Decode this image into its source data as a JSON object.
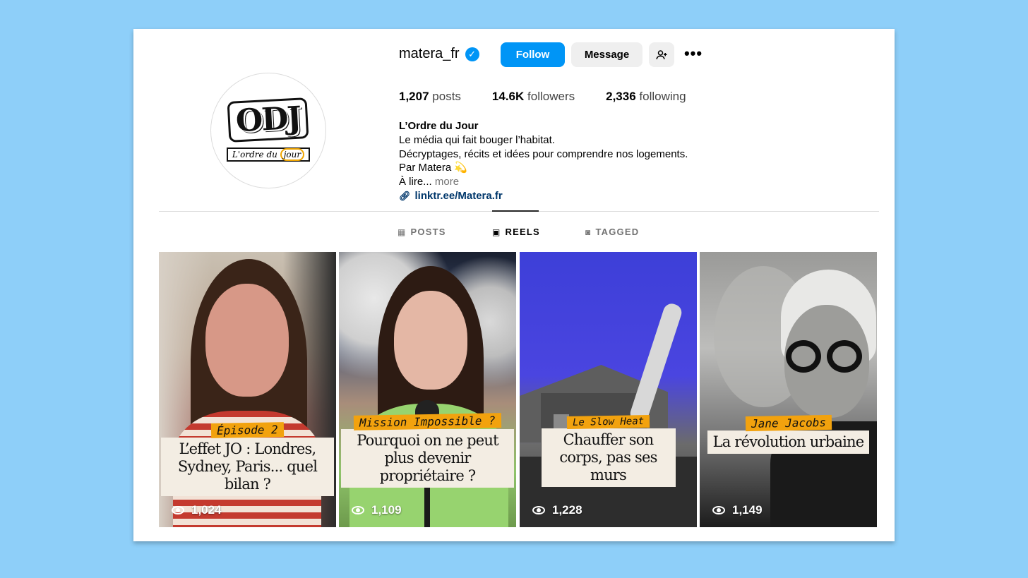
{
  "profile": {
    "username": "matera_fr",
    "verified_icon": "verified-badge-icon",
    "follow_label": "Follow",
    "message_label": "Message",
    "add_user_icon": "add-user-icon",
    "more_icon": "more-options-icon",
    "avatar": {
      "logo_text": "ODJ",
      "logo_subtitle_pre": "L'ordre du",
      "logo_subtitle_highlight": "jour"
    }
  },
  "stats": [
    {
      "value": "1,207",
      "label": "posts"
    },
    {
      "value": "14.6K",
      "label": "followers"
    },
    {
      "value": "2,336",
      "label": "following"
    }
  ],
  "bio": {
    "name": "L’Ordre du Jour",
    "line1": "Le média qui fait bouger l’habitat.",
    "line2": "Décryptages, récits et idées pour comprendre nos logements.",
    "line3": "Par Matera 💫",
    "line4_prefix": "À lire...",
    "more": "more",
    "link": "linktr.ee/Matera.fr"
  },
  "tabs": [
    {
      "label": "POSTS",
      "icon": "grid-icon",
      "active": false
    },
    {
      "label": "REELS",
      "icon": "reels-icon",
      "active": true
    },
    {
      "label": "TAGGED",
      "icon": "tagged-icon",
      "active": false
    }
  ],
  "reels": [
    {
      "tag": "Épisode 2",
      "title": "L’effet JO : Londres, Sydney, Paris... quel bilan ?",
      "views": "1,024"
    },
    {
      "tag": "Mission Impossible ?",
      "title": "Pourquoi on ne peut plus devenir propriétaire ?",
      "views": "1,109"
    },
    {
      "tag": "Le Slow Heat",
      "title": "Chauffer son corps, pas ses murs",
      "views": "1,228"
    },
    {
      "tag": "Jane Jacobs",
      "title": "La révolution urbaine",
      "views": "1,149"
    }
  ],
  "colors": {
    "background": "#8ecff9",
    "accent_blue": "#0095f6",
    "tag_orange": "#f2a20e",
    "link_blue": "#00376b"
  }
}
